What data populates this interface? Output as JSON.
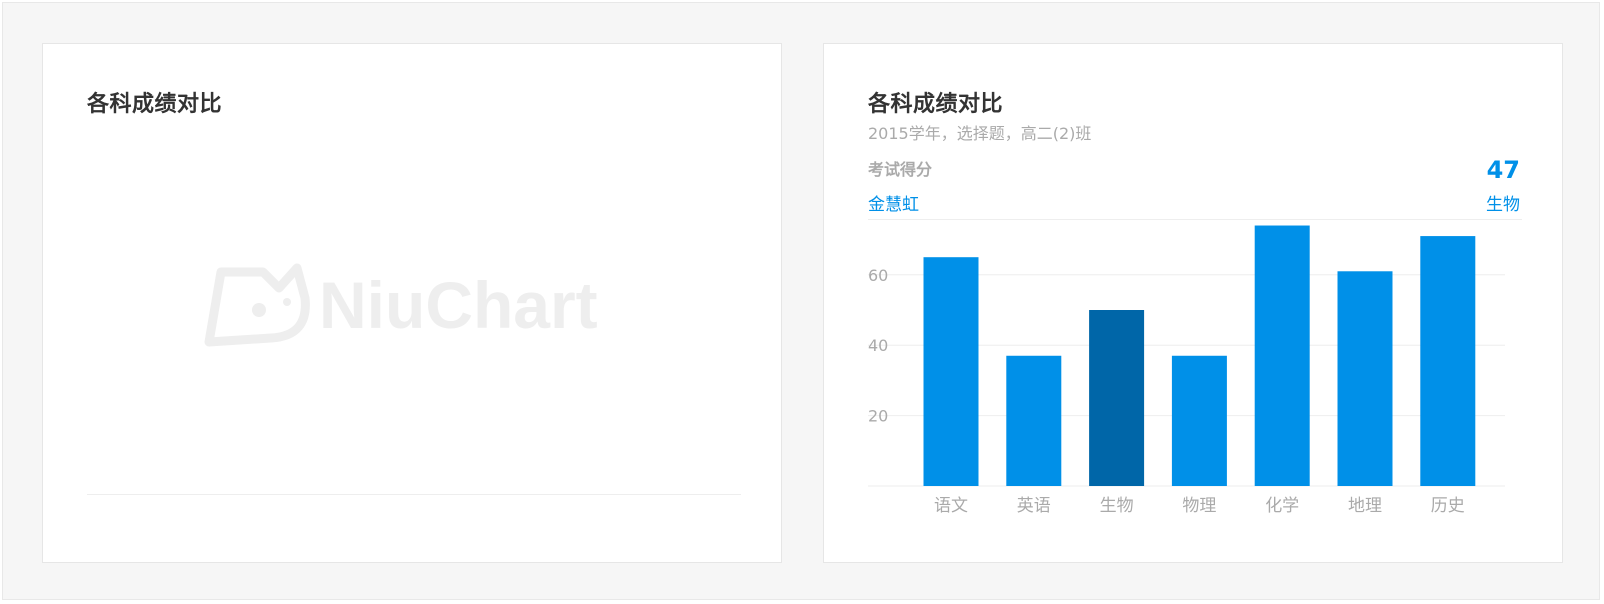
{
  "cards": {
    "left": {
      "title": "各科成绩对比",
      "watermark": "NiuChart"
    },
    "right": {
      "title": "各科成绩对比",
      "subtitle": "2015学年，选择题，高二(2)班",
      "metric_label": "考试得分",
      "metric_value": "47",
      "selected_name": "金慧虹",
      "selected_category": "生物"
    }
  },
  "colors": {
    "accent": "#0090e8",
    "highlight": "#0066a8",
    "grid": "#eeeeee",
    "tick": "#aaaaaa"
  },
  "chart_data": {
    "type": "bar",
    "title": "各科成绩对比",
    "subtitle": "2015学年，选择题，高二(2)班",
    "categories": [
      "语文",
      "英语",
      "生物",
      "物理",
      "化学",
      "地理",
      "历史"
    ],
    "values": [
      65,
      37,
      50,
      37,
      74,
      61,
      71
    ],
    "highlight_index": 2,
    "y_ticks": [
      20,
      40,
      60
    ],
    "ylim": [
      0,
      75
    ],
    "grid": true,
    "legend": "none"
  }
}
